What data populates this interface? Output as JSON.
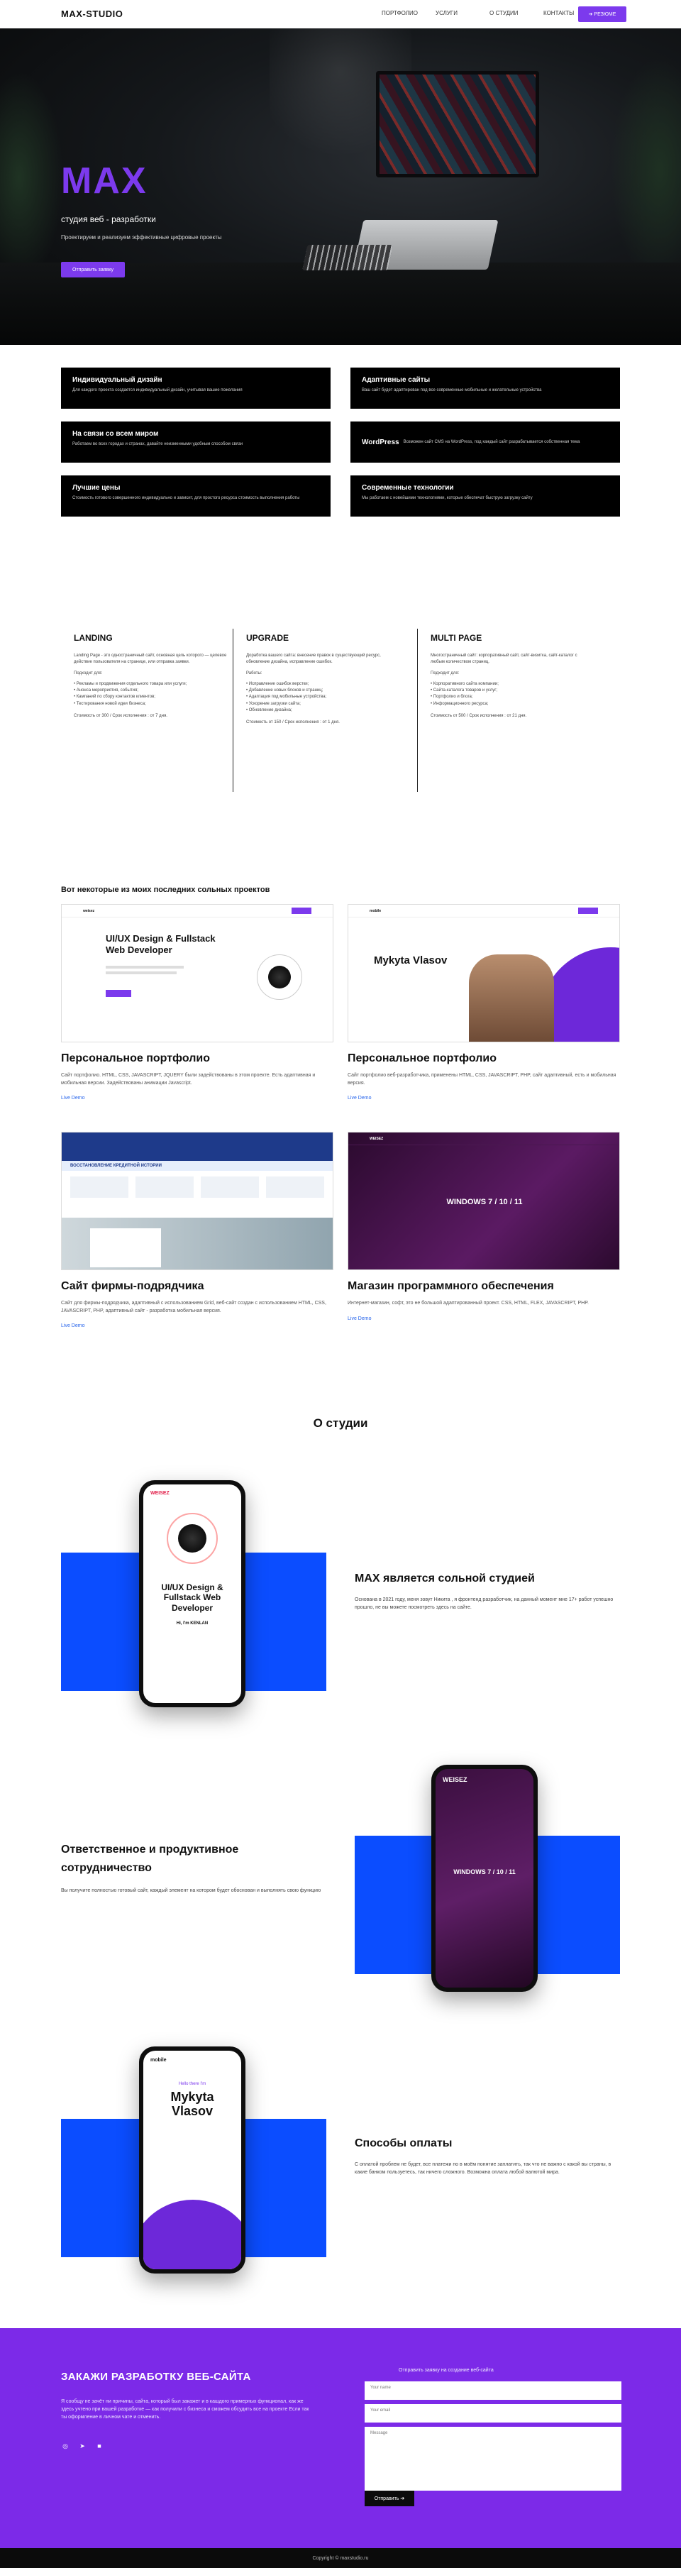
{
  "nav": {
    "brand": "MAX-STUDIO",
    "links": [
      "ПОРТФОЛИО",
      "УСЛУГИ",
      "О СТУДИИ",
      "КОНТАКТЫ"
    ],
    "cta": "➔ РЕЗЮМЕ"
  },
  "hero": {
    "title": "MAX",
    "subtitle": "студия веб - разработки",
    "description": "Проектируем и реализуем эффективные цифровые проекты",
    "button": "Отправить заявку"
  },
  "features": [
    {
      "title": "Индивидуальный дизайн",
      "text": "Для каждого проекта создается индивидуальный дизайн, учитывая вашие пожелания"
    },
    {
      "title": "Адаптивные сайты",
      "text": "Ваш сайт будет адаптирован под все современные мобильные и желательные устройства"
    },
    {
      "title": "На связи со всем миром",
      "text": "Работаем во всех городах и странах, давайте неизменными удобным способом связи"
    },
    {
      "title": "WordPress",
      "text": "Возможен сайт CMS на WordPress, под каждый сайт разрабатывается собственная тема"
    },
    {
      "title": "Лучшие цены",
      "text": "Стоимость готового совершенного индивидуально и зависит, для простого ресурса стоимость выполнения работы"
    },
    {
      "title": "Современные технологии",
      "text": "Мы работаем с новейшими технологиями, которые обеспечат быструю загрузку сайту"
    }
  ],
  "plans": [
    {
      "name": "LANDING",
      "intro": "Landing Page - это одностраничный сайт, основная цель которого — целевое действие пользователя на странице, или отправка заявки.",
      "list_title": "Подходит для:",
      "items": [
        "• Рекламы и продвижения отдельного товара или услуги;",
        "• Анонса мероприятия, события;",
        "• Кампаний по сбору контактов клиентов;",
        "• Тестирования новой идеи бизнеса;"
      ],
      "price": "Стоимость от 300 / Срок исполнения : от 7 дня."
    },
    {
      "name": "UPGRADE",
      "intro": "Доработка вашего сайта: внесение правок в существующий ресурс, обновление дизайна, исправление ошибок.",
      "list_title": "Работы:",
      "items": [
        "• Исправление ошибок верстки;",
        "• Добавление новых блоков и страниц;",
        "• Адаптация под мобильные устройства;",
        "• Ускорение загрузки сайта;",
        "• Обновление дизайна;"
      ],
      "price": "Стоимость от 150 / Срок исполнения : от 1 дня."
    },
    {
      "name": "MULTI PAGE",
      "intro": "Многостраничный сайт: корпоративный сайт, сайт-визитка, сайт-каталог с любым количеством страниц.",
      "list_title": "Подходит для:",
      "items": [
        "• Корпоративного сайта компании;",
        "• Сайта-каталога товаров и услуг;",
        "• Портфолио и блога;",
        "• Информационного ресурса;"
      ],
      "price": "Стоимость от 500 / Срок исполнения : от 21 дня."
    }
  ],
  "portfolio": {
    "title": "Вот некоторые из моих последних сольных проектов",
    "projects": [
      {
        "title": "Персональное портфолио",
        "text": "Сайт портфолио. HTML, CSS, JAVASCRIPT, JQUERY были задействованы в этом проекте. Есть адаптивная и мобильная версии. Задействованы анимации Javascript.",
        "link": "Live Demo",
        "thumb_head": "UI/UX Design & Fullstack Web Developer"
      },
      {
        "title": "Персональное портфолио",
        "text": "Сайт портфолио веб-разработчика, применены HTML, CSS, JAVASCRIPT, PHP, сайт адаптивный, есть и мобильная версия.",
        "link": "Live Demo",
        "thumb_head": "Mykyta Vlasov"
      },
      {
        "title": "Сайт фирмы-подрядчика",
        "text": "Сайт для фирмы-подрядчика, адаптивный с использованием Grid, веб-сайт создан с использованием HTML, CSS, JAVASCRIPT, PHP, адаптивный сайт - разработка мобильная версия.",
        "link": "Live Demo",
        "thumb_head": "ВОССТАНОВЛЕНИЕ КРЕДИТНОЙ ИСТОРИИ"
      },
      {
        "title": "Магазин программного обеспечения",
        "text": "Интернет-магазин, софт, это не большой адаптированный проект. CSS, HTML, FLEX, JAVASCRIPT, PHP.",
        "link": "Live Demo",
        "thumb_head": "WINDOWS 7 / 10 / 11"
      }
    ]
  },
  "about": {
    "title": "О студии",
    "blocks": [
      {
        "heading": "MAX является сольной студией",
        "text": "Основана в 2021 году, меня зовут Никита , я фронтенд разработчик, на данный момент мне 17+ работ успешно прошло, не вы можете посмотреть здесь на сайте."
      },
      {
        "heading": "Ответственное и продуктивное сотрудничество",
        "text": "Вы получите полностью готовый сайт, каждый элемент на котором будет обоснован и выполнять свою функцию"
      },
      {
        "heading": "Способы оплаты",
        "text": "С оплатой проблем не будет, все платежи по в моём понятие заплатить, так что не важно с какой вы страны, в какие банком пользуетесь, так ничего сложного. Возможна оплата любой валютой мира."
      }
    ],
    "phone1": {
      "brand": "WEISEZ",
      "headline": "UI/UX Design & Fullstack Web Developer",
      "name": "Hi, I'm KENLAN"
    },
    "phone2": {
      "brand": "WEISEZ",
      "headline": "WINDOWS 7 / 10 / 11"
    },
    "phone3": {
      "brand": "mobile",
      "hello": "Hello there I'm",
      "name": "Mykyta Vlasov"
    }
  },
  "contact": {
    "title": "ЗАКАЖИ РАЗРАБОТКУ ВЕБ-САЙТА",
    "description": "Я сообщу не зачёт ни причины, сайта, который был закажет и в кашдого примерных функционал, как же здесь учтено при вашей разработке — как получили с бизнеса и сможем обсудить все на проекте Если так ты оформление в личном чате и отменить.",
    "form_title": "Отправить заявку на создание веб-сайта",
    "name_placeholder": "Your name",
    "email_placeholder": "Your email",
    "message_placeholder": "Message",
    "button": "Отправить ➔",
    "socials": [
      "instagram-icon",
      "telegram-icon",
      "linkedin-icon"
    ]
  },
  "footer": {
    "text": "Copyright © maxstudio.ru"
  },
  "colors": {
    "accent": "#7c3aed",
    "blue": "#0b4dff",
    "contact_bg": "#7c2ae8"
  }
}
